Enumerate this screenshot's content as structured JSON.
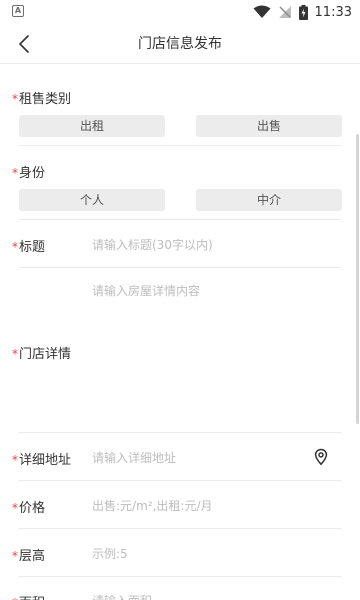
{
  "status_bar": {
    "left_icon": "notification-a-icon",
    "left_icon_text": "A",
    "time": "11:33",
    "icons": [
      "wifi-icon",
      "no-signal-icon",
      "battery-charging-icon"
    ]
  },
  "nav": {
    "title": "门店信息发布",
    "back_icon": "chevron-left-icon"
  },
  "form": {
    "required_mark": "*",
    "rent_sale": {
      "label": "租售类别",
      "options": [
        "出租",
        "出售"
      ]
    },
    "identity": {
      "label": "身份",
      "options": [
        "个人",
        "中介"
      ]
    },
    "title_field": {
      "label": "标题",
      "placeholder": "请输入标题(30字以内)"
    },
    "details": {
      "label": "门店详情",
      "placeholder": "请输入房屋详情内容"
    },
    "address": {
      "label": "详细地址",
      "placeholder": "请输入详细地址",
      "icon": "location-pin-icon"
    },
    "price": {
      "label": "价格",
      "placeholder": "出售:元/m²,出租:元/月"
    },
    "floor_height": {
      "label": "层高",
      "placeholder": "示例:5"
    },
    "area": {
      "label": "面积",
      "placeholder": "请输入面积"
    }
  },
  "colors": {
    "required": "#e0454d",
    "chip_bg": "#ececec",
    "placeholder": "#bdbdbd",
    "divider": "#ececec"
  }
}
